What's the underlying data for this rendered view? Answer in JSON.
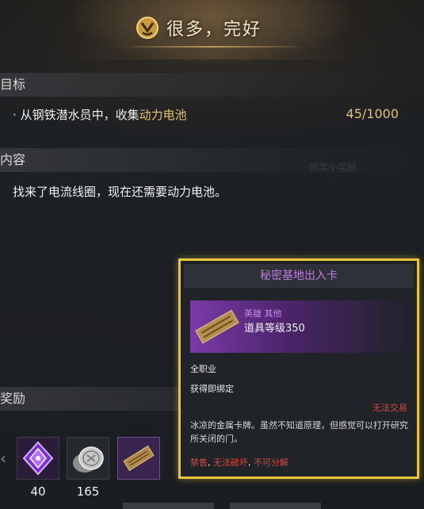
{
  "quest": {
    "title": "很多，完好",
    "sections": {
      "goal": "目标",
      "content": "内容",
      "reward": "奖励"
    },
    "objective": {
      "bullet": "·",
      "prefix": "从钢铁潜水员中，收集",
      "highlight": "动力电池",
      "progress": "45/1000"
    },
    "content_text": "找来了电流线圈，现在还需要动力电池。",
    "ghost_text": "领奖小奖励",
    "rewards": [
      {
        "icon": "purple-gem-icon",
        "count": "40"
      },
      {
        "icon": "silver-coin-icon",
        "count": "165"
      },
      {
        "icon": "card-item-icon",
        "count": ""
      }
    ]
  },
  "tooltip": {
    "title": "秘密基地出入卡",
    "grade": "英雄 其他",
    "item_level": "道具等级350",
    "class": "全职业",
    "bind": "获得即绑定",
    "no_trade": "无法交易",
    "description": "冰凉的金属卡牌。虽然不知道原理，但感觉可以打开研究所关闭的门。",
    "restrictions": [
      "禁售",
      "无法破坏",
      "不可分解"
    ],
    "colors": {
      "border": "#e6c53a",
      "title": "#c07ae0",
      "warning": "#d9463e"
    }
  },
  "nav": {
    "left_arrow": "‹"
  }
}
